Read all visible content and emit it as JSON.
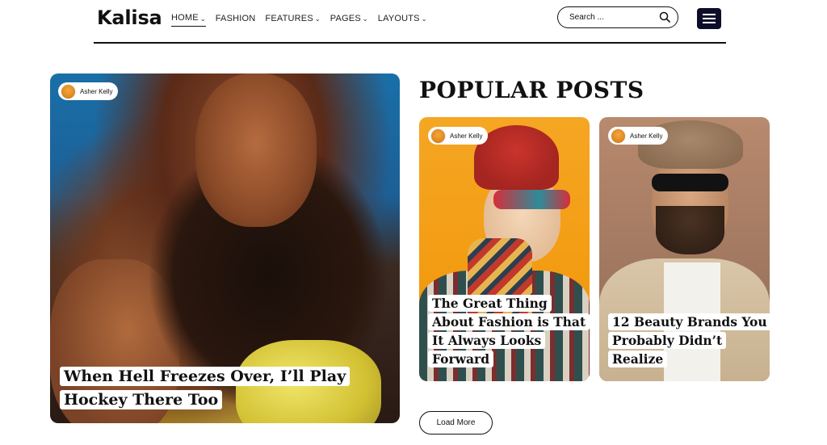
{
  "site": {
    "logo": "Kalisa"
  },
  "nav": {
    "items": [
      {
        "label": "HOME",
        "has_dropdown": true,
        "active": true
      },
      {
        "label": "FASHION",
        "has_dropdown": false,
        "active": false
      },
      {
        "label": "FEATURES",
        "has_dropdown": true,
        "active": false
      },
      {
        "label": "PAGES",
        "has_dropdown": true,
        "active": false
      },
      {
        "label": "LAYOUTS",
        "has_dropdown": true,
        "active": false
      }
    ]
  },
  "search": {
    "placeholder": "Search ...",
    "icon": "search-icon"
  },
  "menu": {
    "icon": "hamburger-icon",
    "color": "#0d0d2a"
  },
  "featured": {
    "author": "Asher Kelly",
    "title": "When Hell Freezes Over, I’ll Play Hockey There Too"
  },
  "popular": {
    "heading": "POPULAR POSTS",
    "posts": [
      {
        "author": "Asher Kelly",
        "title": "The Great Thing About Fashion is That It Always Looks Forward"
      },
      {
        "author": "Asher Kelly",
        "title": "12 Beauty Brands You Probably Didn’t Realize"
      }
    ],
    "load_more": "Load More"
  }
}
